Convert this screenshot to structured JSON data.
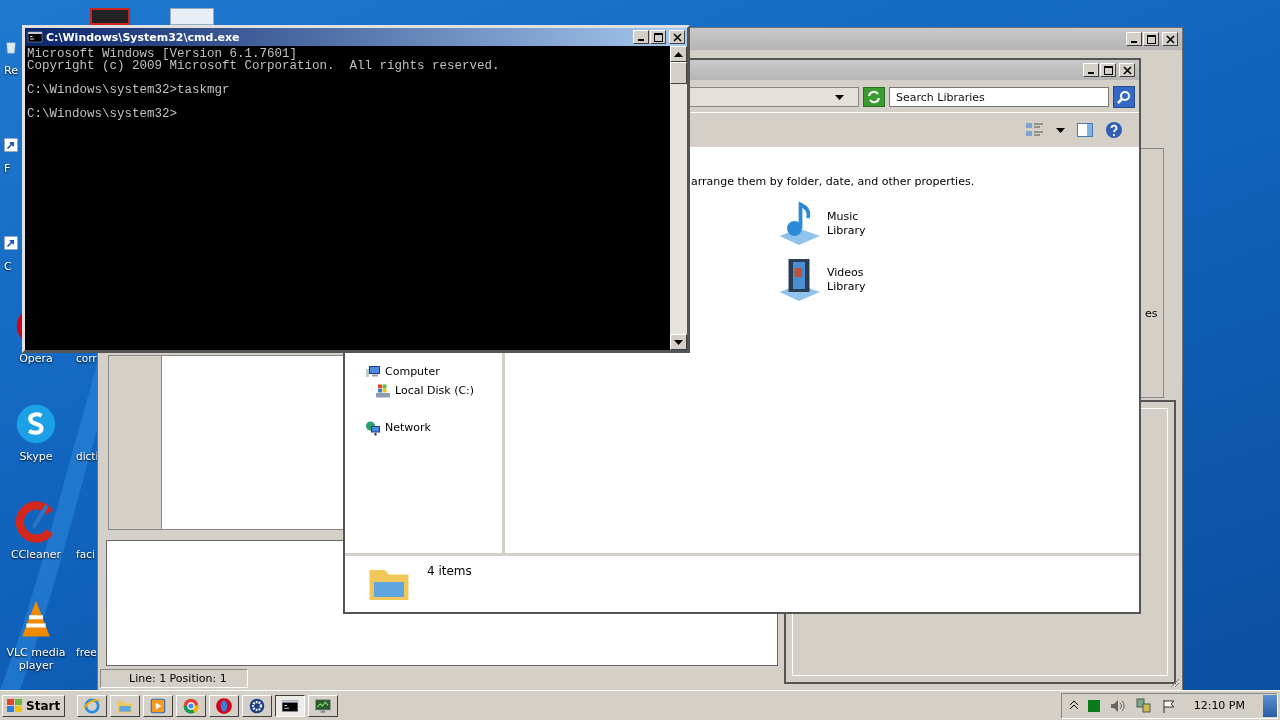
{
  "desktop": {
    "covered_icons": [
      {
        "label": "Re",
        "kind": "recycle"
      },
      {
        "label": "F",
        "kind": "shortcut"
      },
      {
        "label": "C",
        "kind": "shortcut"
      }
    ],
    "icons": [
      {
        "label": "Opera",
        "kind": "opera"
      },
      {
        "label": "Skype",
        "kind": "skype"
      },
      {
        "label": "CCleaner",
        "kind": "ccleaner"
      },
      {
        "label": "VLC media player",
        "kind": "vlc"
      }
    ],
    "second_column": [
      {
        "label": "corr"
      },
      {
        "label": "dicti"
      },
      {
        "label": "faci"
      },
      {
        "label": "free"
      }
    ]
  },
  "background_window": {
    "side_text": "es",
    "status_bar": "Line: 1  Position: 1"
  },
  "explorer": {
    "search": {
      "placeholder": "Search Libraries"
    },
    "description": "arrange them by folder, date, and other properties.",
    "libraries": [
      {
        "name": "Music Library",
        "kind": "music"
      },
      {
        "name": "Videos Library",
        "kind": "videos"
      }
    ],
    "navigation": [
      {
        "label": "Computer",
        "kind": "computer",
        "children": [
          {
            "label": "Local Disk (C:)",
            "kind": "disk"
          }
        ]
      },
      {
        "label": "Network",
        "kind": "network"
      }
    ],
    "details": {
      "count": "4 items"
    }
  },
  "console": {
    "title": "C:\\Windows\\System32\\cmd.exe",
    "blocks": [
      [
        "Microsoft Windows [Version 6.1.7601]",
        "Copyright (c) 2009 Microsoft Corporation.  All rights reserved."
      ],
      [
        "C:\\Windows\\system32>taskmgr"
      ],
      [
        "C:\\Windows\\system32>"
      ]
    ]
  },
  "taskbar": {
    "start": "Start",
    "apps": [
      {
        "kind": "ie",
        "selected": false
      },
      {
        "kind": "folder",
        "selected": false
      },
      {
        "kind": "media",
        "selected": false
      },
      {
        "kind": "chrome",
        "selected": false
      },
      {
        "kind": "opera",
        "selected": false
      },
      {
        "kind": "gear",
        "selected": false
      },
      {
        "kind": "cmd",
        "selected": true
      },
      {
        "kind": "monitor",
        "selected": false
      }
    ],
    "clock": "12:10 PM"
  }
}
